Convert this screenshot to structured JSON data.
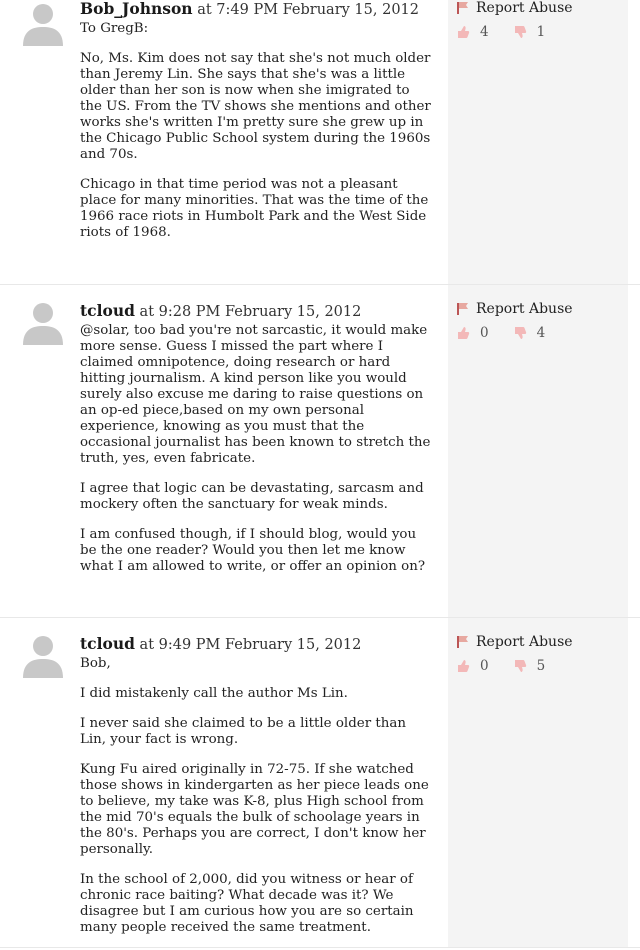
{
  "comments": [
    {
      "author": "Bob_Johnson",
      "timestamp": "at 7:49 PM February 15, 2012",
      "paragraphs": [
        "To GregB:",
        "No, Ms. Kim does not say that she's not much older than Jeremy Lin.  She says that she's was a little older than her son is now when she imigrated to the US.  From the TV shows she mentions and other works she's written I'm pretty sure she grew up in the Chicago Public School system during the 1960s and 70s.",
        "Chicago in that time period was not a pleasant place for many minorities.  That was the time of the 1966 race riots in Humbolt Park and the West Side riots of 1968."
      ],
      "report_label": "Report Abuse",
      "likes": "4",
      "dislikes": "1"
    },
    {
      "author": "tcloud",
      "timestamp": "at 9:28 PM February 15, 2012",
      "paragraphs": [
        "@solar, too bad you're not sarcastic, it would make more sense. Guess I missed the part where I claimed omnipotence, doing research or hard hitting journalism. A kind person like you would surely also excuse me daring to raise questions on an op-ed piece,based on my own personal experience, knowing as you must that the occasional journalist has been known to stretch the truth, yes, even fabricate.",
        "I agree that logic can be devastating, sarcasm and mockery often the sanctuary for weak minds.",
        "I am confused though, if I should blog, would you be the one reader? Would you then let me know what I am allowed to write, or offer an opinion on?"
      ],
      "report_label": "Report Abuse",
      "likes": "0",
      "dislikes": "4"
    },
    {
      "author": "tcloud",
      "timestamp": "at 9:49 PM February 15, 2012",
      "paragraphs": [
        "Bob,",
        "I did mistakenly call the author Ms Lin.",
        "I never said she claimed to be a little older than Lin, your fact is wrong.",
        "Kung Fu aired originally in 72-75. If she watched those shows in kindergarten as her piece leads one to believe, my take was K-8, plus High school from the mid 70's equals the bulk of schoolage years in the 80's. Perhaps you are correct, I don't know her personally.",
        "In the school of 2,000, did you witness or hear of chronic race baiting? What decade was it? We disagree but I am curious how you are so certain many people received the same treatment."
      ],
      "report_label": "Report Abuse",
      "likes": "0",
      "dislikes": "5"
    }
  ]
}
